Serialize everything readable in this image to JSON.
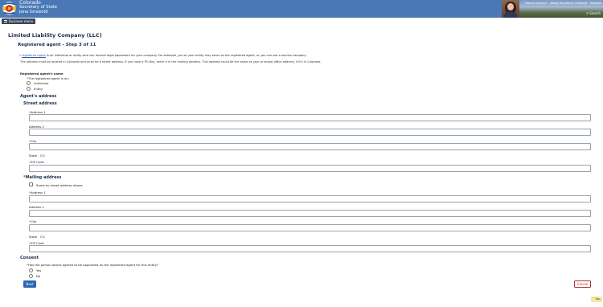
{
  "header": {
    "org_line1": "Colorado",
    "org_line2": "Secretary of State",
    "org_line3": "Jena Griswold",
    "links": [
      "How to contact",
      "About Secretary Griswold",
      "Español"
    ],
    "search_label": "Search"
  },
  "menu": {
    "label": "Business menu"
  },
  "page": {
    "title": "Limited Liability Company (LLC)",
    "step": "Registered agent - Step 3 of 11",
    "bullet_link": "registered agent",
    "bullet_text": " is an individual or entity who can receive legal paperwork for your company. For example, you or your entity may serve as the registered agent, or you can use a service company.",
    "address_note": "The address must be located in Colorado and must be a street address. If you have a PO Box, enter it in the mailing address. This address could be the same as your principal office address, if it's in Colorado."
  },
  "agent_name": {
    "heading": "Registered agent's name",
    "question": "The registered agent is an:",
    "options": [
      "Individual",
      "Entity"
    ]
  },
  "agent_address": {
    "heading": "Agent's address",
    "street_heading": "Street address",
    "address1_label": "Address 1",
    "address2_label": "Address 2",
    "city_label": "City",
    "state_label": "State",
    "state_value": "CO",
    "zip_label": "ZIP Code"
  },
  "mailing": {
    "heading": "Mailing address",
    "same_label": "Same as street address above",
    "address1_label": "Address 1",
    "address2_label": "Address 2",
    "city_label": "City",
    "state_label": "State",
    "state_value": "CO",
    "zip_label": "ZIP Code"
  },
  "consent": {
    "heading": "Consent",
    "question": "Has the person above agreed to be appointed as the registered agent for this entity?",
    "options": [
      "Yes",
      "No"
    ]
  },
  "buttons": {
    "next": "Next",
    "cancel": "Cancel",
    "top": "Top"
  },
  "colors": {
    "header_bg": "#4a78b5",
    "heading": "#1a2e4f",
    "next_bg": "#2a66b1",
    "cancel": "#b03030"
  }
}
